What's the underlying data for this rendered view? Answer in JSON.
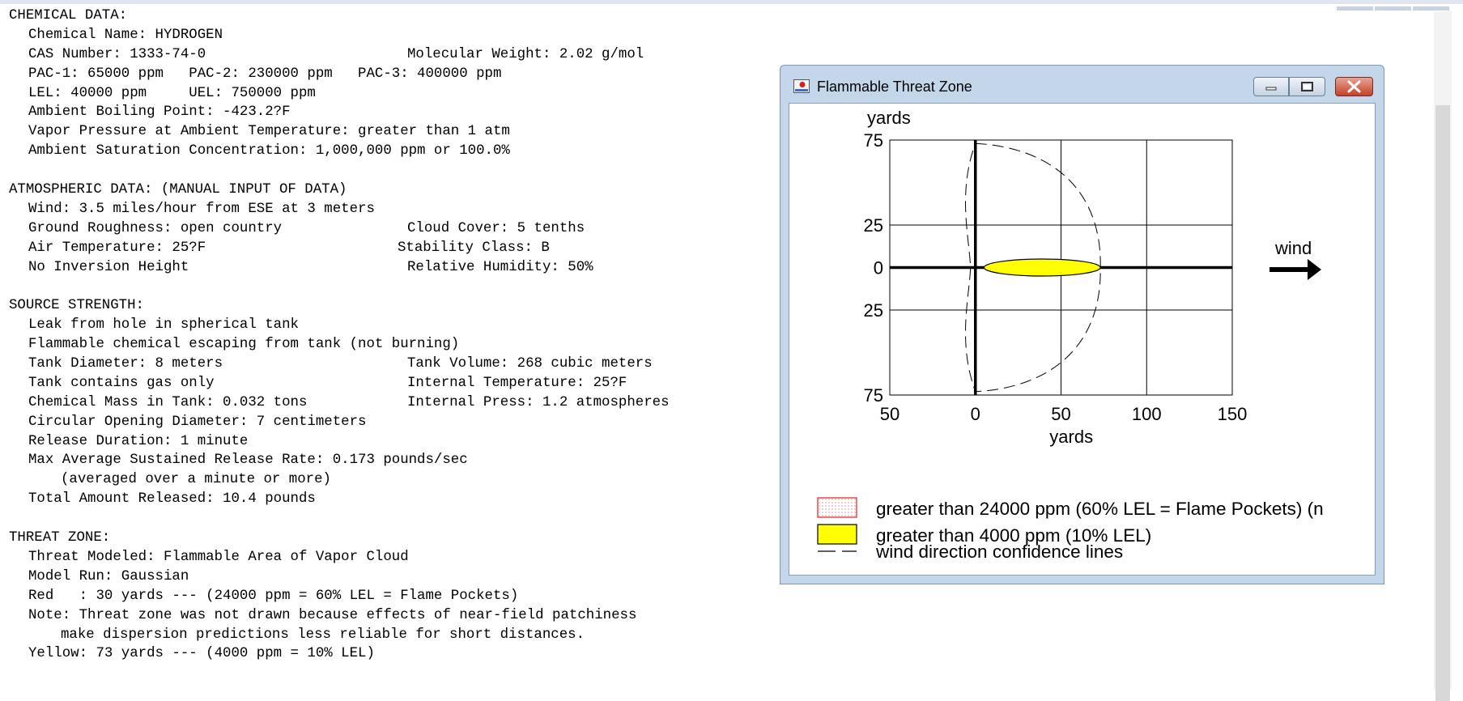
{
  "report": {
    "chemical": {
      "heading": "CHEMICAL DATA:",
      "name": "Chemical Name: HYDROGEN",
      "cas": "CAS Number: 1333-74-0",
      "mw": "Molecular Weight: 2.02 g/mol",
      "pac": "PAC-1: 65000 ppm   PAC-2: 230000 ppm   PAC-3: 400000 ppm",
      "lel": "LEL: 40000 ppm     UEL: 750000 ppm",
      "boiling": "Ambient Boiling Point: -423.2?F",
      "vapor": "Vapor Pressure at Ambient Temperature: greater than 1 atm",
      "saturation": "Ambient Saturation Concentration: 1,000,000 ppm or 100.0%"
    },
    "atmospheric": {
      "heading": "ATMOSPHERIC DATA: (MANUAL INPUT OF DATA)",
      "wind": "Wind: 3.5 miles/hour from ESE at 3 meters",
      "roughness": "Ground Roughness: open country",
      "cloud": "Cloud Cover: 5 tenths",
      "air_temp": "Air Temperature: 25?F",
      "stability": "Stability Class: B",
      "inversion": "No Inversion Height",
      "humidity": "Relative Humidity: 50%"
    },
    "source": {
      "heading": "SOURCE STRENGTH:",
      "leak": "Leak from hole in spherical tank",
      "escaping": "Flammable chemical escaping from tank (not burning)",
      "diameter": "Tank Diameter: 8 meters",
      "volume": "Tank Volume: 268 cubic meters",
      "contains": "Tank contains gas only",
      "internal_temp": "Internal Temperature: 25?F",
      "mass": "Chemical Mass in Tank: 0.032 tons",
      "press": "Internal Press: 1.2 atmospheres",
      "opening": "Circular Opening Diameter: 7 centimeters",
      "duration": "Release Duration: 1 minute",
      "max_rate": "Max Average Sustained Release Rate: 0.173 pounds/sec",
      "averaged": "(averaged over a minute or more)",
      "total": "Total Amount Released: 10.4 pounds"
    },
    "threat": {
      "heading": "THREAT ZONE:",
      "modeled": "Threat Modeled: Flammable Area of Vapor Cloud",
      "model_run": "Model Run: Gaussian",
      "red": "Red   : 30 yards --- (24000 ppm = 60% LEL = Flame Pockets)",
      "note1": "Note: Threat zone was not drawn because effects of near-field patchiness",
      "note2": "make dispersion predictions less reliable for short distances.",
      "yellow": "Yellow: 73 yards --- (4000 ppm = 10% LEL)"
    }
  },
  "window": {
    "title": "Flammable Threat Zone"
  },
  "chart_data": {
    "type": "area",
    "ylabel": "yards",
    "xlabel": "yards",
    "xlim": [
      -50,
      150
    ],
    "ylim": [
      -75,
      75
    ],
    "x_ticks": [
      "50",
      "0",
      "50",
      "100",
      "150"
    ],
    "y_ticks": [
      "75",
      "25",
      "0",
      "25",
      "75"
    ],
    "grid": true,
    "wind_label": "wind",
    "yellow_zone": {
      "name": "greater than 4000 ppm (10% LEL)",
      "x_start": 5,
      "x_end": 73,
      "half_width": 5,
      "color": "#ffff00"
    },
    "confidence_lines": {
      "name": "wind direction confidence lines",
      "x_reach": 73,
      "y_extent": 73
    },
    "legend": [
      {
        "label": "greater than 24000 ppm (60% LEL = Flame Pockets) (n",
        "swatch": "red-dotted"
      },
      {
        "label": "greater than 4000 ppm (10% LEL)",
        "swatch": "yellow"
      },
      {
        "label": "wind direction confidence lines",
        "swatch": "dashed"
      }
    ]
  }
}
